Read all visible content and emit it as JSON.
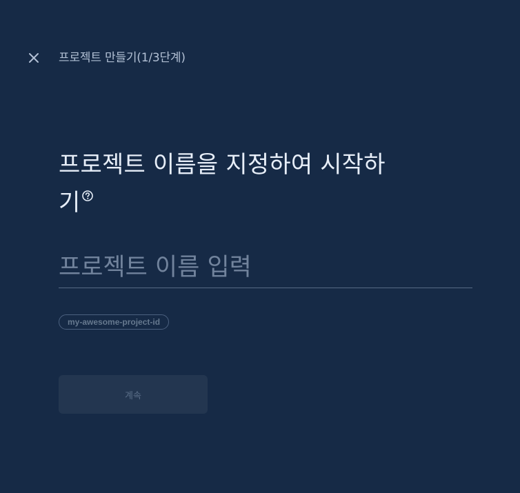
{
  "header": {
    "close_icon": "close-icon",
    "title": "프로젝트 만들기(1/3단계)"
  },
  "main": {
    "heading": "프로젝트 이름을 지정하여 시작하기",
    "help_icon": "help-circle-icon",
    "name_input": {
      "value": "",
      "placeholder": "프로젝트 이름 입력"
    },
    "project_id": "my-awesome-project-id",
    "continue_label": "계속",
    "continue_disabled": true
  },
  "colors": {
    "background": "#162a46",
    "heading_text": "#e7eef8",
    "header_text": "#b3c1d5",
    "placeholder_text": "#71839c",
    "input_underline": "#566a85",
    "chip_border": "#4c6180",
    "button_bg_disabled": "#233650",
    "button_text_disabled": "#5a6e88"
  }
}
